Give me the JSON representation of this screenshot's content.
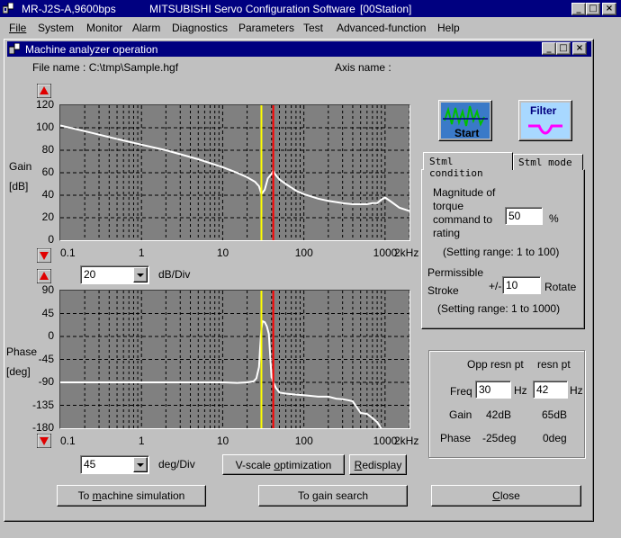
{
  "app": {
    "title_left": "MR-J2S-A,9600bps",
    "title_main": "MITSUBISHI Servo Configuration Software",
    "title_station": "[00Station]"
  },
  "menu": [
    "File",
    "System",
    "Monitor",
    "Alarm",
    "Diagnostics",
    "Parameters",
    "Test",
    "Advanced-function",
    "Help"
  ],
  "child": {
    "title": "Machine analyzer operation"
  },
  "file": {
    "label": "File name : C:\\tmp\\Sample.hgf",
    "axis_label": "Axis name :"
  },
  "gain_plot": {
    "label_line1": "Gain",
    "label_line2": "[dB]",
    "yticks": [
      "120",
      "100",
      "80",
      "60",
      "40",
      "20",
      "0"
    ],
    "xticks": [
      "0.1",
      "1",
      "10",
      "100",
      "1000"
    ],
    "xunit": "2kHz",
    "scale_value": "20",
    "scale_unit": "dB/Div"
  },
  "phase_plot": {
    "label_line1": "Phase",
    "label_line2": "[deg]",
    "yticks": [
      "90",
      "45",
      "0",
      "-45",
      "-90",
      "-135",
      "-180"
    ],
    "xticks": [
      "0.1",
      "1",
      "10",
      "100",
      "1000"
    ],
    "xunit": "2kHz",
    "scale_value": "45",
    "scale_unit": "deg/Div"
  },
  "chart_data": [
    {
      "type": "line",
      "xscale": "log",
      "xlim": [
        0.1,
        2000
      ],
      "ylim": [
        0,
        120
      ],
      "ylabel": "Gain [dB]",
      "x": [
        0.1,
        0.2,
        0.5,
        1,
        2,
        5,
        10,
        15,
        20,
        25,
        28,
        30,
        33,
        36,
        40,
        42,
        45,
        50,
        60,
        80,
        100,
        150,
        200,
        300,
        400,
        500,
        600,
        700,
        800,
        900,
        1000,
        1200,
        1500,
        2000
      ],
      "y": [
        102,
        97,
        90,
        85,
        80,
        72,
        65,
        60,
        56,
        52,
        48,
        41,
        45,
        55,
        59,
        62,
        58,
        54,
        50,
        44,
        41,
        37,
        35,
        33,
        32,
        32,
        32,
        33,
        33,
        36,
        38,
        34,
        29,
        26
      ],
      "markers": [
        {
          "name": "Opp resn pt",
          "x": 30,
          "color": "#ffff00"
        },
        {
          "name": "resn pt",
          "x": 42,
          "color": "#ff0000"
        }
      ],
      "grid": true
    },
    {
      "type": "line",
      "xscale": "log",
      "xlim": [
        0.1,
        2000
      ],
      "ylim": [
        -180,
        90
      ],
      "ylabel": "Phase [deg]",
      "x": [
        0.1,
        1,
        5,
        10,
        15,
        20,
        24,
        26,
        28,
        29,
        30,
        31,
        33,
        35,
        37,
        40,
        45,
        50,
        60,
        80,
        100,
        150,
        200,
        250,
        300,
        350,
        400,
        500,
        600,
        700,
        800,
        900
      ],
      "y": [
        -90,
        -90,
        -90,
        -90,
        -91,
        -90,
        -88,
        -82,
        -60,
        -20,
        15,
        30,
        28,
        20,
        5,
        -80,
        -100,
        -110,
        -112,
        -114,
        -115,
        -118,
        -118,
        -122,
        -123,
        -125,
        -127,
        -150,
        -152,
        -160,
        -168,
        -180
      ],
      "markers": [
        {
          "name": "Opp resn pt",
          "x": 30,
          "color": "#ffff00"
        },
        {
          "name": "resn pt",
          "x": 42,
          "color": "#ff0000"
        }
      ],
      "grid": true
    }
  ],
  "buttons": {
    "start": "Start",
    "filter": "Filter",
    "vscale": "V-scale optimization",
    "redisplay": "Redisplay",
    "to_sim": "To machine simulation",
    "to_gain": "To gain search",
    "close": "Close"
  },
  "tabs": [
    "Stml condition",
    "Stml mode"
  ],
  "stml": {
    "mag_label_1": "Magnitude of",
    "mag_label_2": "torque",
    "mag_label_3": "command to",
    "mag_label_4": "rating",
    "mag_value": "50",
    "mag_unit": "%",
    "mag_range": "(Setting range: 1 to 100)",
    "stroke_label_1": "Permissible",
    "stroke_label_2": "Stroke",
    "stroke_pm": "+/-",
    "stroke_value": "10",
    "stroke_unit": "Rotate",
    "stroke_range": "(Setting range: 1 to 1000)"
  },
  "resn": {
    "col1": "Opp resn pt",
    "col2": "resn pt",
    "freq_label": "Freq",
    "freq1": "30",
    "freq2": "42",
    "hz": "Hz",
    "gain_label": "Gain",
    "gain1": "42dB",
    "gain2": "65dB",
    "phase_label": "Phase",
    "phase1": "-25deg",
    "phase2": "0deg"
  }
}
